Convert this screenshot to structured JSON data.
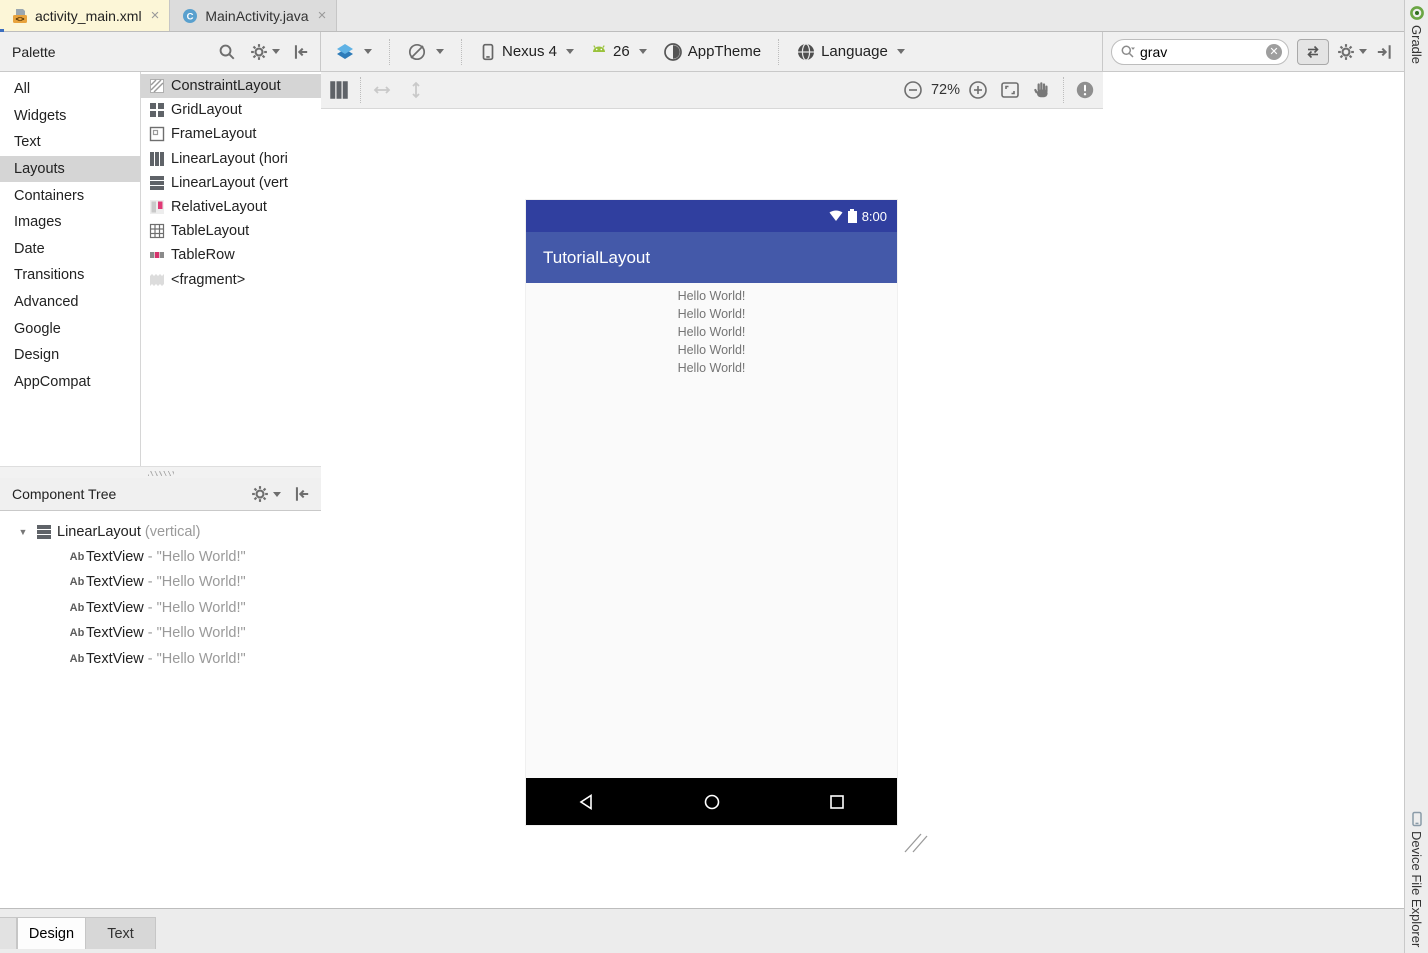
{
  "editor_tabs": {
    "tab1": {
      "label": "activity_main.xml"
    },
    "tab2": {
      "label": "MainActivity.java"
    },
    "close_glyph": "×"
  },
  "palette": {
    "title": "Palette",
    "categories": [
      "All",
      "Widgets",
      "Text",
      "Layouts",
      "Containers",
      "Images",
      "Date",
      "Transitions",
      "Advanced",
      "Google",
      "Design",
      "AppCompat"
    ],
    "selected_category": "Layouts",
    "items": [
      {
        "label": "ConstraintLayout",
        "selected": true
      },
      {
        "label": "GridLayout"
      },
      {
        "label": "FrameLayout"
      },
      {
        "label": "LinearLayout (hori"
      },
      {
        "label": "LinearLayout (vert"
      },
      {
        "label": "RelativeLayout"
      },
      {
        "label": "TableLayout"
      },
      {
        "label": "TableRow"
      },
      {
        "label": "<fragment>"
      }
    ]
  },
  "toolbar": {
    "device_label": "Nexus 4",
    "api_label": "26",
    "theme_label": "AppTheme",
    "language_label": "Language"
  },
  "search": {
    "value": "grav"
  },
  "surface": {
    "zoom_label": "72%"
  },
  "component_tree": {
    "title": "Component Tree",
    "root_type": "LinearLayout",
    "root_suffix": "(vertical)",
    "children": [
      {
        "type": "TextView",
        "text": "- \"Hello World!\""
      },
      {
        "type": "TextView",
        "text": "- \"Hello World!\""
      },
      {
        "type": "TextView",
        "text": "- \"Hello World!\""
      },
      {
        "type": "TextView",
        "text": "- \"Hello World!\""
      },
      {
        "type": "TextView",
        "text": "- \"Hello World!\""
      }
    ]
  },
  "preview": {
    "time": "8:00",
    "title": "TutorialLayout",
    "texts": [
      "Hello World!",
      "Hello World!",
      "Hello World!",
      "Hello World!",
      "Hello World!"
    ],
    "colors": {
      "status_bar": "#303F9F",
      "app_bar": "#4459A9",
      "content_bg": "#FAFAFA",
      "nav_bar": "#000000"
    }
  },
  "bottom_tabs": {
    "design": "Design",
    "text": "Text"
  },
  "right_stripe": {
    "top_label": "Gradle",
    "bottom_label": "Device File Explorer"
  }
}
